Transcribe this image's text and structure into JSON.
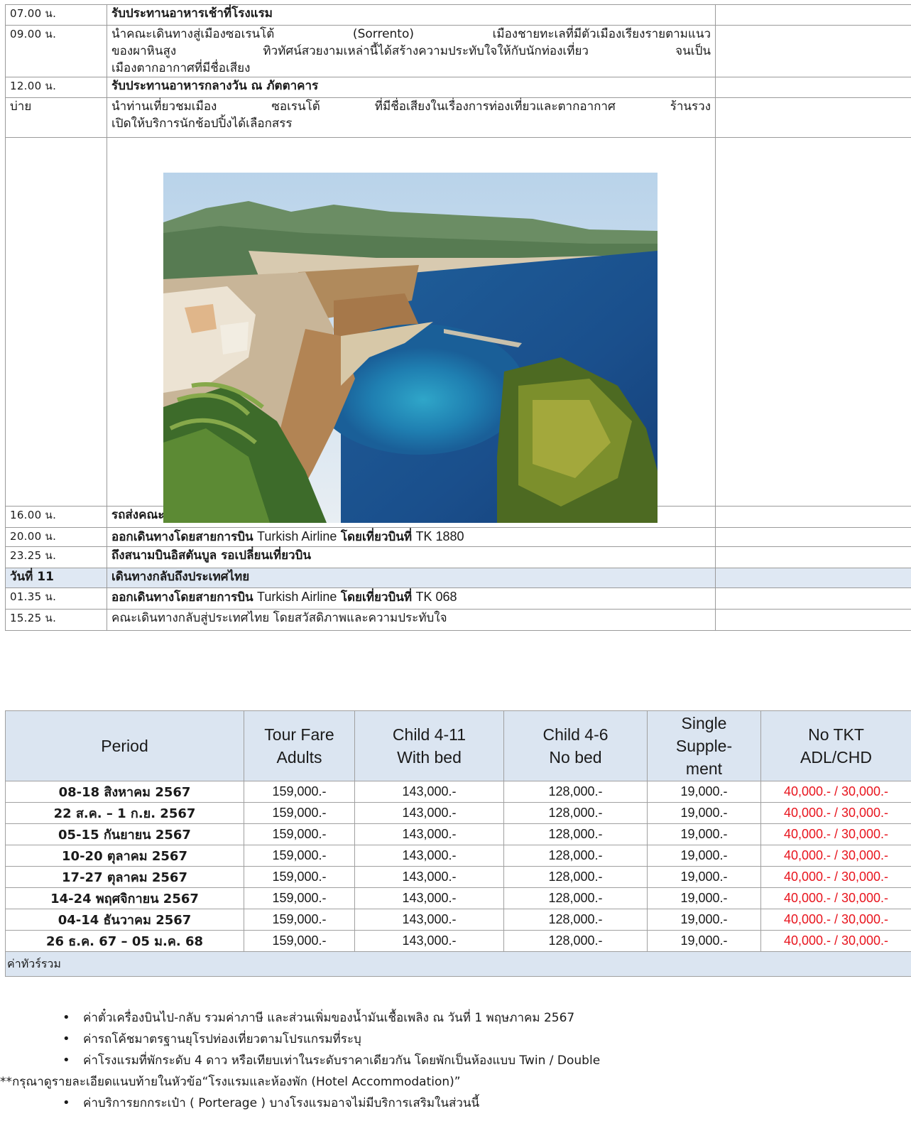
{
  "itinerary": [
    {
      "time": "07.00 น.",
      "text": "รับประทานอาหารเช้าที่โรงแรม"
    },
    {
      "time": "09.00 น.",
      "lines": [
        "นำคณะเดินทางสู่เมืองซอเรนโต้ (Sorrento) เมืองชายทะเลที่มีตัวเมืองเรียงรายตามแนว",
        "ของผาหินสูง ทิวทัศน์สวยงามเหล่านี้ได้สร้างความประทับใจให้กับนักท่องเที่ยว จนเป็น",
        "เมืองตากอากาศที่มีชื่อเสียง"
      ]
    },
    {
      "time": "12.00 น.",
      "text": "รับประทานอาหารกลางวัน ณ ภัตตาคาร"
    },
    {
      "time": "บ่าย",
      "lines": [
        "นำท่านเที่ยวชมเมือง ซอเรนโต้ ที่มีชื่อเสียงในเรื่องการท่องเที่ยวและตากอากาศ ร้านรวง",
        "เปิดให้บริการนักช้อปปิ้งได้เลือกสรร"
      ]
    },
    {
      "time": "16.00 น.",
      "text": "รถส่งคณะที่สนามบินนาโปลี เพื่อทำการเช็คอิน"
    },
    {
      "time": "20.00 น.",
      "text_a": "ออกเดินทางโดยสายการบิน",
      "text_b": "Turkish Airline",
      "text_c": "โดยเที่ยวบินที่",
      "text_d": "TK 1880"
    },
    {
      "time": "23.25 น.",
      "text": "ถึงสนามบินอิสตันบูล รอเปลี่ยนเที่ยวบิน"
    },
    {
      "time": "วันที่ 11",
      "text": "เดินทางกลับถึงประเทศไทย"
    },
    {
      "time": "01.35 น.",
      "text_a": "ออกเดินทางโดยสายการบิน",
      "text_b": "Turkish Airline",
      "text_c": "โดยเที่ยวบินที่",
      "text_d": "TK 068"
    },
    {
      "time": "15.25 น.",
      "text": "คณะเดินทางกลับสู่ประเทศไทย โดยสวัสดิภาพและความประทับใจ"
    }
  ],
  "price_table": {
    "headers": [
      {
        "l1": "Period",
        "l2": "",
        "l3": ""
      },
      {
        "l1": "Tour Fare",
        "l2": "Adults",
        "l3": ""
      },
      {
        "l1": "Child 4-11",
        "l2": "With bed",
        "l3": ""
      },
      {
        "l1": "Child 4-6",
        "l2": "No bed",
        "l3": ""
      },
      {
        "l1": "Single",
        "l2": "Supple-",
        "l3": "ment"
      },
      {
        "l1": "No TKT",
        "l2": "ADL/CHD",
        "l3": ""
      }
    ],
    "rows": [
      {
        "period": "08-18 สิงหาคม 2567",
        "adult": "159,000.-",
        "child_bed": "143,000.-",
        "child_nobed": "128,000.-",
        "single": "19,000.-",
        "no_tkt": "40,000.- / 30,000.-"
      },
      {
        "period": "22 ส.ค. – 1 ก.ย. 2567",
        "adult": "159,000.-",
        "child_bed": "143,000.-",
        "child_nobed": "128,000.-",
        "single": "19,000.-",
        "no_tkt": "40,000.- / 30,000.-"
      },
      {
        "period": "05-15 กันยายน 2567",
        "adult": "159,000.-",
        "child_bed": "143,000.-",
        "child_nobed": "128,000.-",
        "single": "19,000.-",
        "no_tkt": "40,000.- / 30,000.-"
      },
      {
        "period": "10-20 ตุลาคม 2567",
        "adult": "159,000.-",
        "child_bed": "143,000.-",
        "child_nobed": "128,000.-",
        "single": "19,000.-",
        "no_tkt": "40,000.- / 30,000.-"
      },
      {
        "period": "17-27 ตุลาคม 2567",
        "adult": "159,000.-",
        "child_bed": "143,000.-",
        "child_nobed": "128,000.-",
        "single": "19,000.-",
        "no_tkt": "40,000.- / 30,000.-"
      },
      {
        "period": "14-24 พฤศจิกายน 2567",
        "adult": "159,000.-",
        "child_bed": "143,000.-",
        "child_nobed": "128,000.-",
        "single": "19,000.-",
        "no_tkt": "40,000.- / 30,000.-"
      },
      {
        "period": "04-14 ธันวาคม 2567",
        "adult": "159,000.-",
        "child_bed": "143,000.-",
        "child_nobed": "128,000.-",
        "single": "19,000.-",
        "no_tkt": "40,000.- / 30,000.-"
      },
      {
        "period": "26 ธ.ค. 67 – 05 ม.ค. 68",
        "adult": "159,000.-",
        "child_bed": "143,000.-",
        "child_nobed": "128,000.-",
        "single": "19,000.-",
        "no_tkt": "40,000.- / 30,000.-"
      }
    ],
    "section_label": "ค่าทัวร์รวม"
  },
  "includes": [
    "ค่าตั๋วเครื่องบินไป-กลับ รวมค่าภาษี และส่วนเพิ่มของน้ำมันเชื้อเพลิง ณ วันที่ 1 พฤษภาคม 2567",
    "ค่ารถโค้ชมาตรฐานยุโรปท่องเที่ยวตามโปรแกรมที่ระบุ",
    "ค่าโรงแรมที่พักระดับ 4 ดาว หรือเทียบเท่าในระดับราคาเดียวกัน โดยพักเป็นห้องแบบ Twin / Double"
  ],
  "note": "**กรุณาดูรายละเอียดแนบท้ายในหัวข้อ“โรงแรมและห้องพัก (Hotel Accommodation)”",
  "includes_2": [
    "ค่าบริการยกกระเป๋า ( Porterage ) บางโรงแรมอาจไม่มีบริการเสริมในส่วนนี้"
  ],
  "colors": {
    "header_bg": "#dbe5f1",
    "day_row_bg": "#dfe8f3",
    "no_tkt_red": "#e8141d",
    "border": "#9a9a9a"
  }
}
